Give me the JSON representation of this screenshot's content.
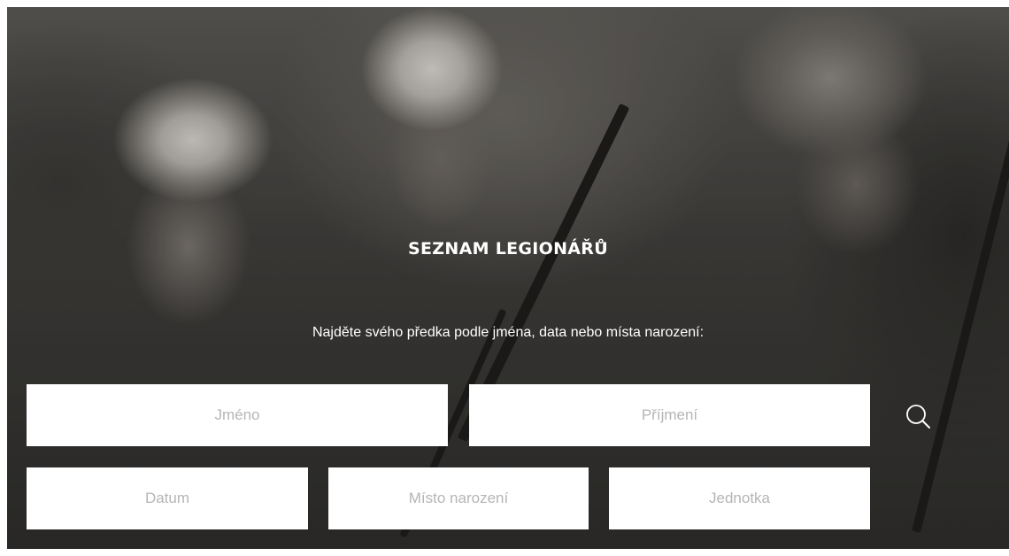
{
  "header": {
    "title": "SEZNAM LEGIONÁŘŮ",
    "subtitle": "Najděte svého předka podle jména, data nebo místa narození:"
  },
  "search_form": {
    "first_name_placeholder": "Jméno",
    "last_name_placeholder": "Příjmení",
    "date_placeholder": "Datum",
    "birthplace_placeholder": "Místo narození",
    "unit_placeholder": "Jednotka",
    "search_icon": "search-icon"
  },
  "colors": {
    "text": "#ffffff",
    "placeholder": "#b5b5b5",
    "field_background": "#ffffff"
  }
}
